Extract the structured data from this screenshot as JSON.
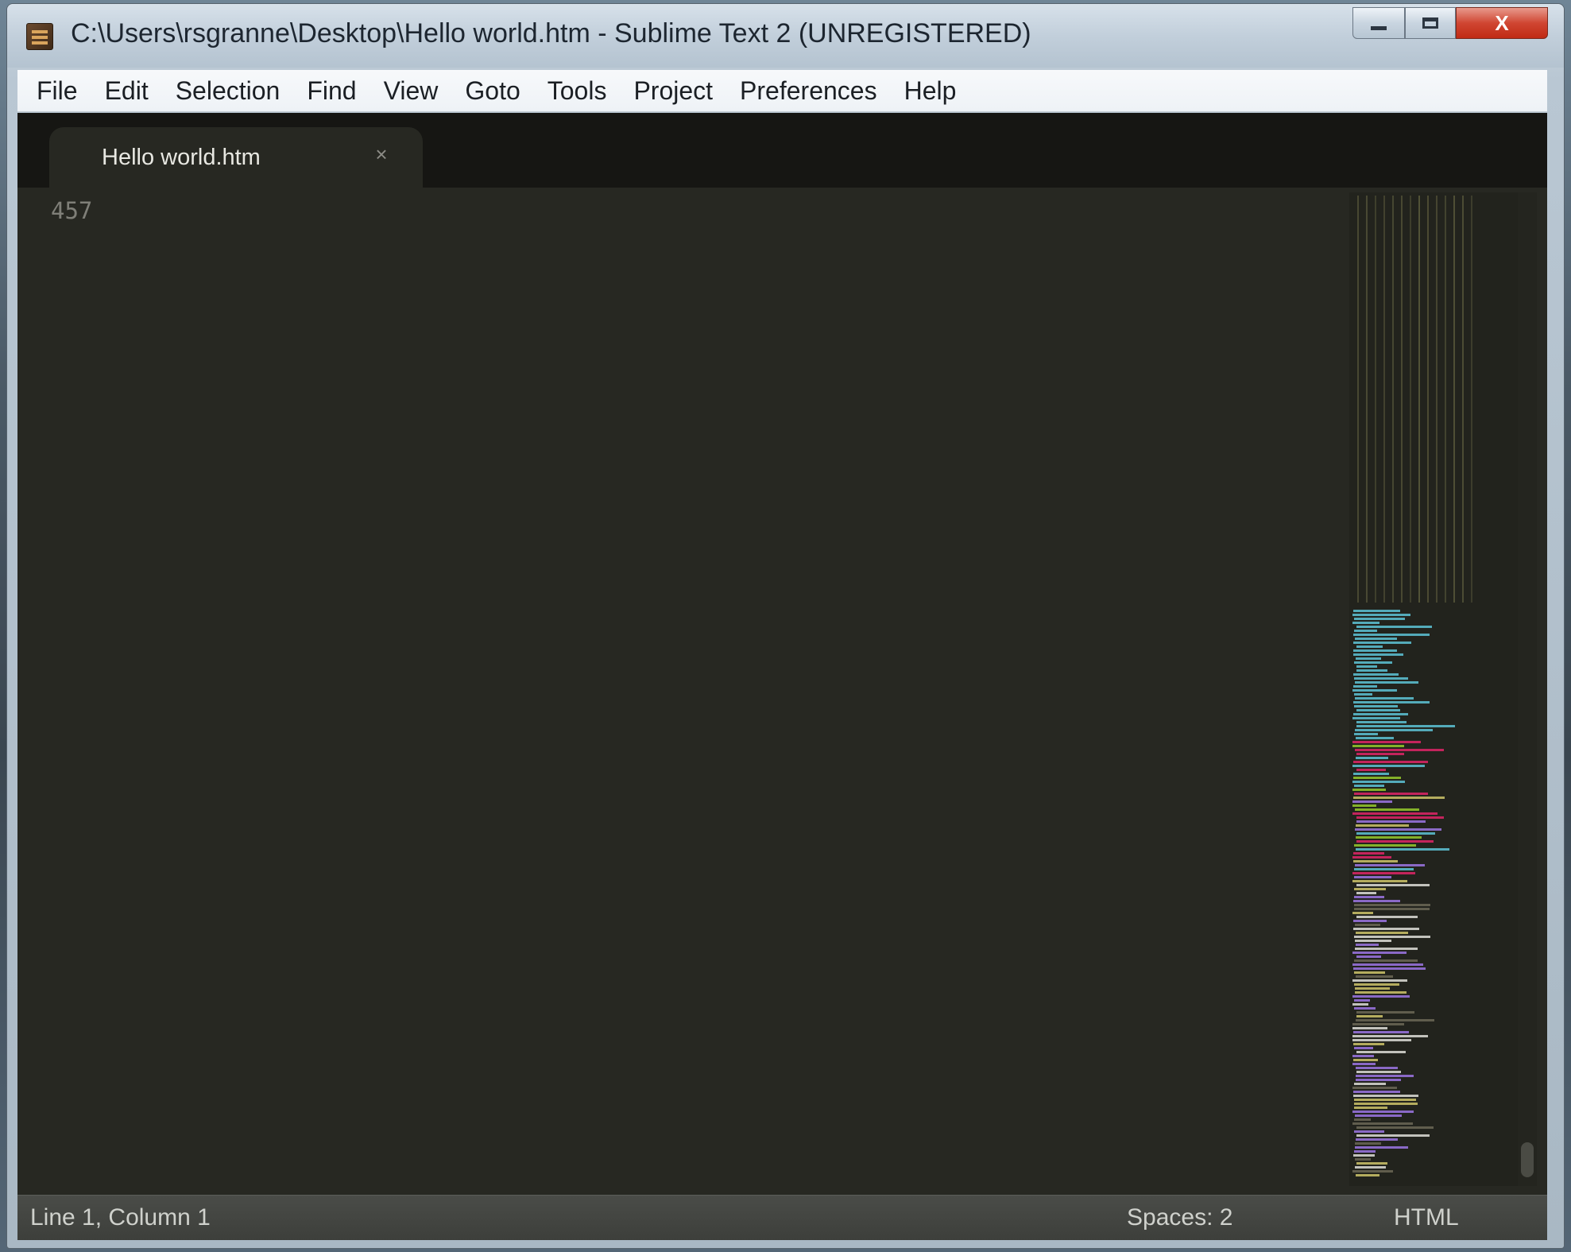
{
  "window": {
    "title": "C:\\Users\\rsgranne\\Desktop\\Hello world.htm - Sublime Text 2 (UNREGISTERED)",
    "close_label": "X"
  },
  "menu": [
    "File",
    "Edit",
    "Selection",
    "Find",
    "View",
    "Goto",
    "Tools",
    "Project",
    "Preferences",
    "Help"
  ],
  "tab": {
    "label": "Hello world.htm",
    "close_label": "×"
  },
  "editor": {
    "line_number": "457"
  },
  "statusbar": {
    "position": "Line 1, Column 1",
    "indentation": "Spaces: 2",
    "syntax": "HTML"
  },
  "colors": {
    "editor_bg": "#272822",
    "tabstrip_bg": "#161613",
    "statusbar_bg": "#444641"
  }
}
